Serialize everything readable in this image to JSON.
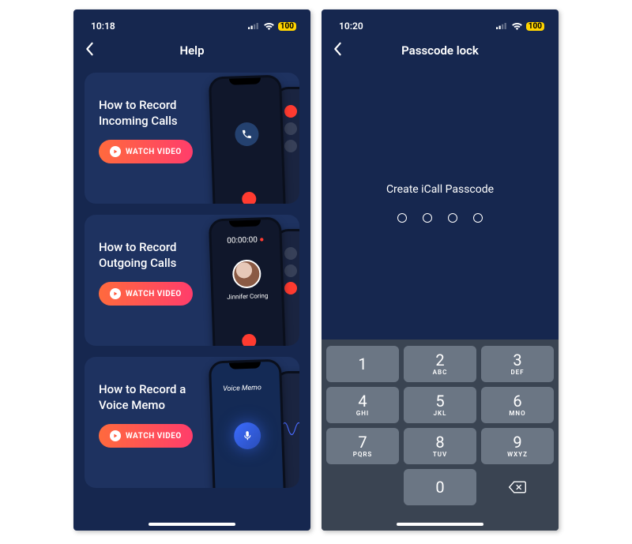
{
  "left": {
    "status": {
      "time": "10:18",
      "battery": "100"
    },
    "nav": {
      "title": "Help"
    },
    "cards": [
      {
        "title": "How to Record Incoming Calls",
        "button": "WATCH VIDEO"
      },
      {
        "title": "How to Record Outgoing Calls",
        "button": "WATCH VIDEO",
        "timer": "00:00:00",
        "caller": "Jinnifer Coring"
      },
      {
        "title": "How to Record a Voice Memo",
        "button": "WATCH VIDEO",
        "voice_label": "Voice Memo"
      }
    ]
  },
  "right": {
    "status": {
      "time": "10:20",
      "battery": "100"
    },
    "nav": {
      "title": "Passcode lock"
    },
    "prompt": "Create iCall Passcode",
    "keypad": [
      {
        "num": "1",
        "letters": ""
      },
      {
        "num": "2",
        "letters": "ABC"
      },
      {
        "num": "3",
        "letters": "DEF"
      },
      {
        "num": "4",
        "letters": "GHI"
      },
      {
        "num": "5",
        "letters": "JKL"
      },
      {
        "num": "6",
        "letters": "MNO"
      },
      {
        "num": "7",
        "letters": "PQRS"
      },
      {
        "num": "8",
        "letters": "TUV"
      },
      {
        "num": "9",
        "letters": "WXYZ"
      },
      {
        "num": "0",
        "letters": ""
      }
    ]
  }
}
